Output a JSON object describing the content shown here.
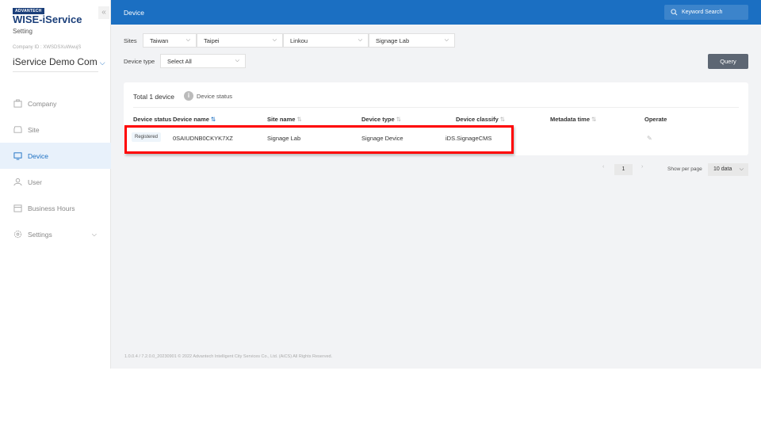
{
  "brand": {
    "badge": "ADVANTECH",
    "title": "WISE-iService",
    "subtitle": "Setting"
  },
  "sidebar": {
    "company_id": "Company ID : XWSDSXuWwujS",
    "company_name": "iService Demo Com",
    "items": [
      {
        "label": "Company",
        "icon": "company-icon"
      },
      {
        "label": "Site",
        "icon": "site-icon"
      },
      {
        "label": "Device",
        "icon": "monitor-icon",
        "active": true
      },
      {
        "label": "User",
        "icon": "user-icon"
      },
      {
        "label": "Business Hours",
        "icon": "calendar-icon"
      },
      {
        "label": "Settings",
        "icon": "gear-icon"
      }
    ]
  },
  "header": {
    "title": "Device",
    "search_placeholder": "Keyword Search"
  },
  "filters": {
    "sites_label": "Sites",
    "sites": [
      "Taiwan",
      "Taipei",
      "Linkou",
      "Signage Lab"
    ],
    "device_type_label": "Device type",
    "device_type": "Select All",
    "query_label": "Query"
  },
  "table": {
    "total": "Total 1 device",
    "status_link": "Device status",
    "columns": [
      "Device status",
      "Device name",
      "Site name",
      "Device type",
      "Device classify",
      "Metadata time",
      "Operate"
    ],
    "rows": [
      {
        "status": "Registered",
        "name": "0SAIUDNB0CKYK7XZ",
        "site": "Signage Lab",
        "type": "Signage Device",
        "classify": "iDS.SignageCMS",
        "metadata_time": ""
      }
    ]
  },
  "pagination": {
    "prev": "‹",
    "page": "1",
    "next": "›",
    "per_page_label": "Show per page",
    "per_page": "10 data"
  },
  "footer": "1.0.0.4 / 7.2.0.0_20230901 © 2022 Advantech Intelligent City Services Co., Ltd. (AiCS) All Rights Reserved.",
  "colors": {
    "primary": "#1b6fc2",
    "highlight": "#ff0000"
  }
}
